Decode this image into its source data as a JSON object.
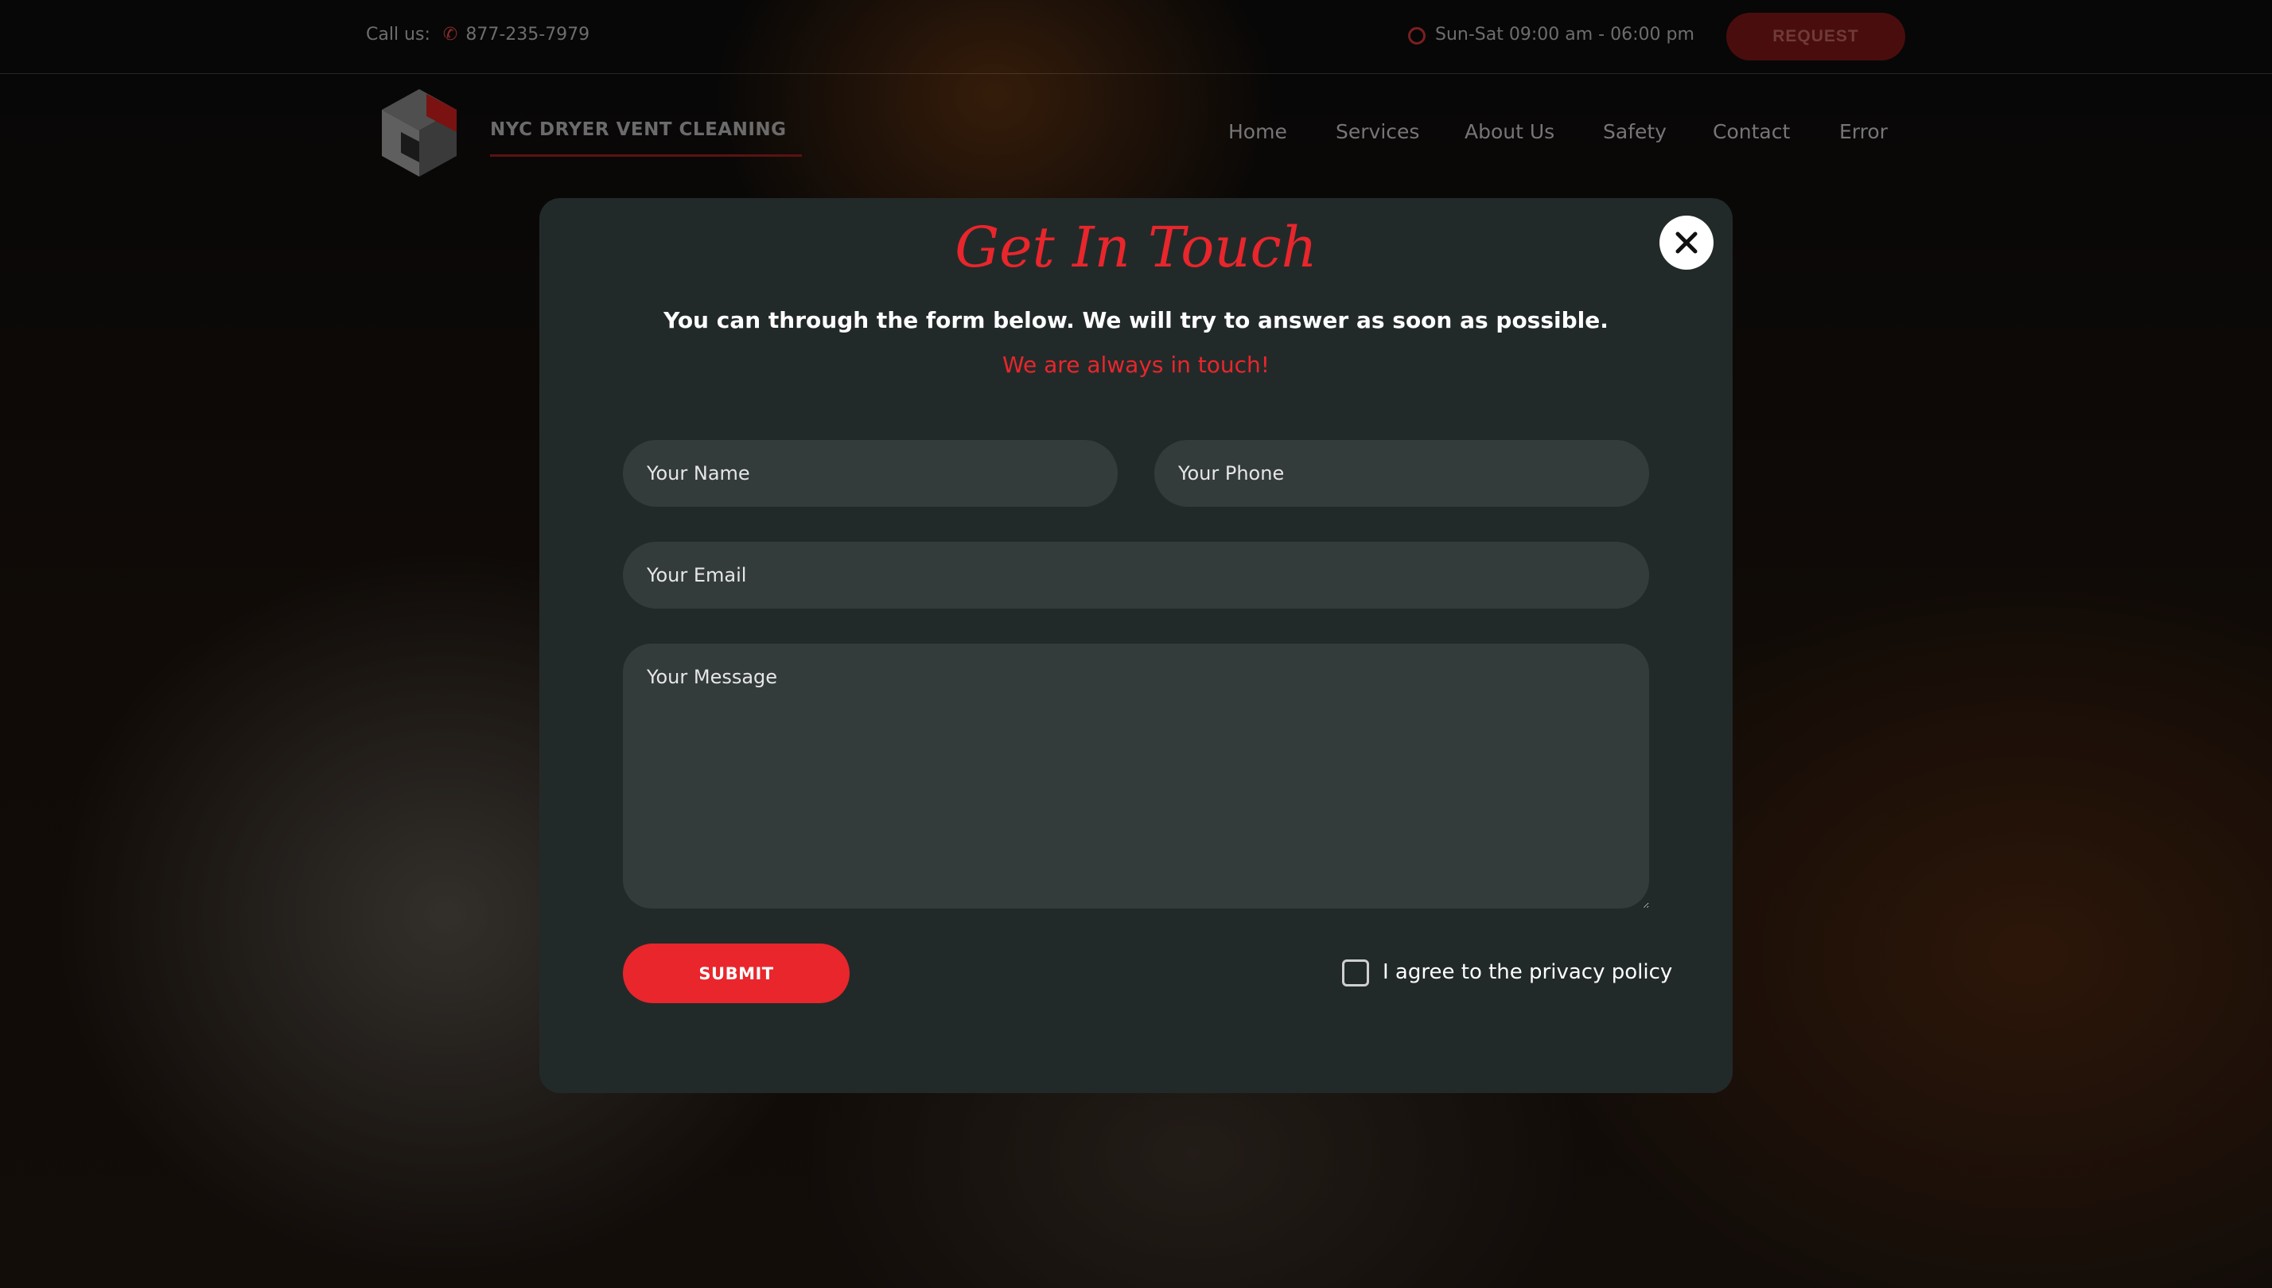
{
  "topbar": {
    "call_label": "Call us:",
    "phone": "877-235-7979",
    "hours": "Sun-Sat 09:00 am - 06:00 pm",
    "request_label": "REQUEST"
  },
  "brand": {
    "name": "NYC DRYER VENT CLEANING"
  },
  "nav": {
    "items": [
      {
        "label": "Home"
      },
      {
        "label": "Services"
      },
      {
        "label": "About Us"
      },
      {
        "label": "Safety"
      },
      {
        "label": "Contact"
      },
      {
        "label": "Error"
      }
    ]
  },
  "modal": {
    "title": "Get In Touch",
    "subtitle": "You can through the form below. We will try to answer as soon as possible.",
    "tagline": "We are always in touch!",
    "fields": {
      "name_placeholder": "Your Name",
      "phone_placeholder": "Your Phone",
      "email_placeholder": "Your Email",
      "message_placeholder": "Your Message"
    },
    "submit_label": "SUBMIT",
    "privacy_label": "I agree to the privacy policy",
    "privacy_checked": false
  },
  "colors": {
    "accent": "#e8262c",
    "modal_bg": "#222a29",
    "field_bg": "#343c3b"
  },
  "icons": [
    "phone-icon",
    "clock-icon",
    "logo-icon",
    "close-icon",
    "checkbox-icon"
  ]
}
